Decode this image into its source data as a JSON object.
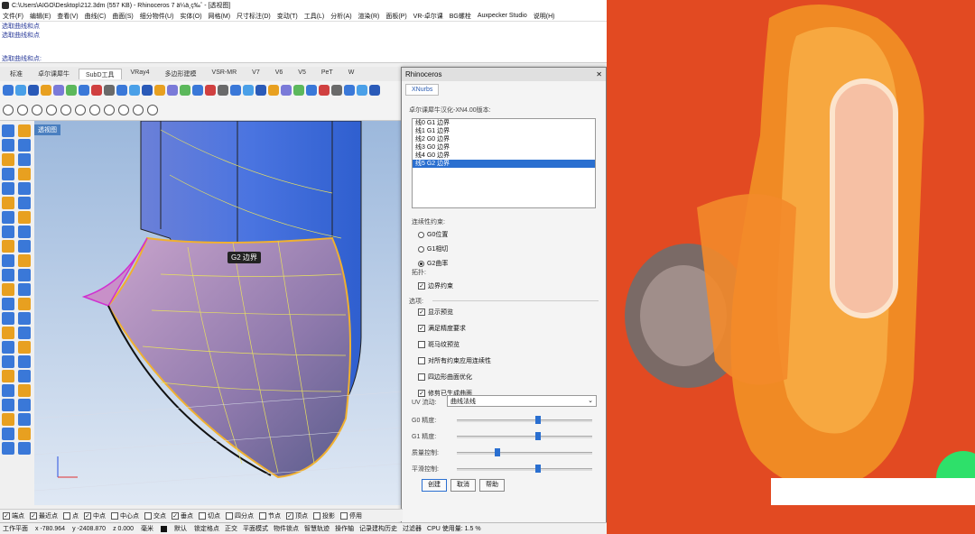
{
  "window": {
    "title": "C:\\Users\\AIGO\\Desktop\\212.3dm (557 KB) - Rhinoceros 7 ä¼ä¸ç‰ˆ - [透视图]"
  },
  "menu": [
    "文件(F)",
    "编辑(E)",
    "查看(V)",
    "曲线(C)",
    "曲面(S)",
    "细分物件(U)",
    "实体(O)",
    "网格(M)",
    "尺寸标注(D)",
    "变动(T)",
    "工具(L)",
    "分析(A)",
    "渲染(R)",
    "面板(P)",
    "VR-卓尔课",
    "BG螺栓",
    "Auxpecker Studio",
    "说明(H)"
  ],
  "command_history": [
    "选取曲线和点",
    "选取曲线和点"
  ],
  "command_prompt": "选取曲线和点:",
  "tabs": [
    "标准",
    "卓尔课犀牛",
    "SubD工具",
    "VRay4",
    "多边形建模",
    "VSR-MR",
    "V7",
    "V6",
    "V5",
    "PeT",
    "W"
  ],
  "active_tab": "SubD工具",
  "viewport": {
    "label": "透视图",
    "tooltip": "G2 边界"
  },
  "dialog": {
    "title": "Rhinoceros",
    "tab": "XNurbs",
    "version": "卓尔课犀牛汉化-XN4.00版本:",
    "list": [
      "线0   G1   边界",
      "线1   G1   边界",
      "线2   G0   边界",
      "线3   G0   边界",
      "线4   G0   边界",
      "线5   G2   边界"
    ],
    "continuity_label": "连续性约束:",
    "radios": [
      "G0位置",
      "G1相切",
      "G2曲率"
    ],
    "topo_label": "拓扑:",
    "boundary_constraint": "边界约束",
    "options_label": "选项:",
    "options": [
      "显示预览",
      "满足精度要求",
      "斑马纹预览",
      "对所有约束应用连续性",
      "四边形曲面优化",
      "修剪已生成曲面"
    ],
    "options_checked": [
      true,
      true,
      false,
      false,
      false,
      true
    ],
    "uv_label": "UV 流动:",
    "uv_value": "曲线法线",
    "sliders": [
      {
        "label": "G0 精度:",
        "value": 0.6
      },
      {
        "label": "G1 精度:",
        "value": 0.6
      },
      {
        "label": "质量控制:",
        "value": 0.3
      },
      {
        "label": "平滑控制:",
        "value": 0.6
      }
    ],
    "buttons": [
      "创建",
      "取消",
      "帮助"
    ]
  },
  "osnap": [
    "端点",
    "最近点",
    "点",
    "中点",
    "中心点",
    "交点",
    "垂点",
    "切点",
    "四分点",
    "节点",
    "顶点",
    "投影",
    "停用"
  ],
  "osnap_checked": [
    true,
    true,
    false,
    true,
    false,
    false,
    true,
    false,
    false,
    false,
    true,
    false,
    false
  ],
  "status": {
    "cplane": "工作平面",
    "x": "x -780.964",
    "y": "y -2408.870",
    "z": "z 0.000",
    "unit": "毫米",
    "layer": "默认",
    "items": [
      "锁定格点",
      "正交",
      "平面模式",
      "物件锁点",
      "智慧轨迹",
      "操作轴",
      "记录建构历史",
      "过滤器",
      "CPU 使用量: 1.5 %"
    ]
  },
  "colors": {
    "accent": "#2a6fd0",
    "photo_bg": "#e24a22",
    "surface": "#9a80ae"
  }
}
